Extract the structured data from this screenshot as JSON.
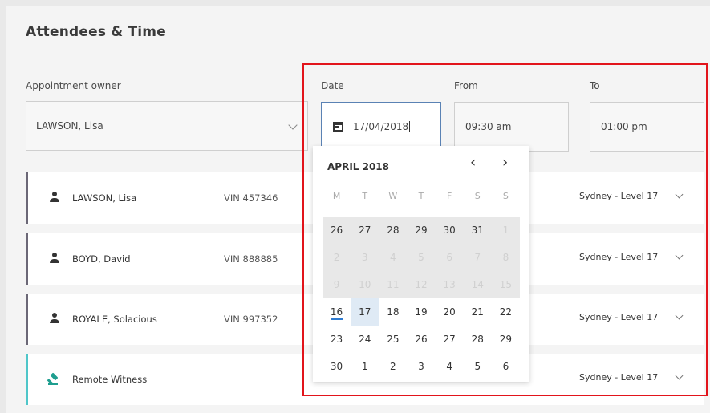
{
  "section": {
    "title": "Attendees & Time"
  },
  "owner": {
    "label": "Appointment owner",
    "value": "LAWSON, Lisa"
  },
  "date": {
    "label": "Date",
    "value": "17/04/2018"
  },
  "from": {
    "label": "From",
    "value": "09:30 am"
  },
  "to": {
    "label": "To",
    "value": "01:00 pm"
  },
  "attendees": [
    {
      "name": "LAWSON, Lisa",
      "vin": "VIN 457346",
      "location": "Sydney - Level 17"
    },
    {
      "name": "BOYD, David",
      "vin": "VIN 888885",
      "location": "Sydney - Level 17"
    },
    {
      "name": "ROYALE, Solacious",
      "vin": "VIN 997352",
      "location": "Sydney - Level 17"
    },
    {
      "name": "Remote Witness",
      "vin": "",
      "location": "Sydney - Level 17"
    }
  ],
  "calendar": {
    "month_label": "APRIL 2018",
    "prev": "‹",
    "next": "›",
    "weekdays": [
      "M",
      "T",
      "W",
      "T",
      "F",
      "S",
      "S"
    ],
    "weeks": [
      [
        "26",
        "27",
        "28",
        "29",
        "30",
        "31",
        "1"
      ],
      [
        "2",
        "3",
        "4",
        "5",
        "6",
        "7",
        "8"
      ],
      [
        "9",
        "10",
        "11",
        "12",
        "13",
        "14",
        "15"
      ],
      [
        "16",
        "17",
        "18",
        "19",
        "20",
        "21",
        "22"
      ],
      [
        "23",
        "24",
        "25",
        "26",
        "27",
        "28",
        "29"
      ],
      [
        "30",
        "1",
        "2",
        "3",
        "4",
        "5",
        "6"
      ]
    ],
    "today": "16",
    "selected": "17"
  },
  "colors": {
    "accent": "#2f7bd0",
    "highlight_border": "#e2141b",
    "teal_bar": "#4fc6c9"
  }
}
